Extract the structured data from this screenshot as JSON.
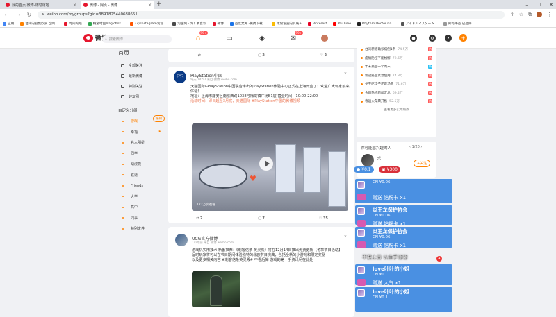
{
  "browser": {
    "tabs": [
      {
        "title": "我的首页 微博-随时随地"
      },
      {
        "title": "微博 - 网页 - 微博"
      }
    ],
    "url": "weibo.com/mygroups?gid=3891825440688651",
    "bookmarks": [
      "应用",
      "台湾的剧集欣赏 全网...",
      "时间的线",
      "畅游时空Magicbox...",
      "(7) Instagram发现...",
      "淘宝网 - 淘！我喜欢",
      "微博",
      "百度文库 -免费下载...",
      "无限设置的扩展+",
      "Pinterest",
      "YouTube",
      "Rhythm Doctor Co...",
      "アイドルマスター S...",
      "所有书签 已选择..."
    ]
  },
  "header": {
    "logo": "微博",
    "search_placeholder": "搜索微博",
    "nav_badge_home": "99+",
    "nav_badge_msg": "99+",
    "compose": "+"
  },
  "leftnav": {
    "title": "首页",
    "main_items": [
      "全部关注",
      "最新微博",
      "特别关注",
      "好友圈"
    ],
    "group_title": "自定义分组",
    "edit_label": "编辑",
    "groups": [
      "游戏",
      "幸福",
      "名人明星",
      "同学",
      "动漫党",
      "铁道",
      "Friends",
      "大学",
      "高中",
      "同事",
      "特别文件"
    ]
  },
  "feedtop": {
    "repost": "",
    "comment": "2",
    "like": "2"
  },
  "post1": {
    "name": "PlayStation中国",
    "meta": "今天 14:57 来自 微博 weibo.com",
    "text1": "天猫国际&PlayStation中国联合推出的PlayStation体验中心正式在上海开业了！欢迎广大玩家前来体验！",
    "text2": "地址：上海市静安区南京西路1038号梅龙镇广场B1层  营业时间：10:00-22:00",
    "text3": "活动时间：即日起至3月底，天猫国际 #PlayStation中国的微博视频",
    "video_label": "172万次观看",
    "actions": {
      "repost": "2",
      "comment": "7",
      "like": "35"
    }
  },
  "post2": {
    "name": "UCG官方微博",
    "meta": "1小时前 来自 微博 weibo.com",
    "text1": "游戏机实用技术 新番推荐：《刺客信条 英灵殿》将在12月14日推出免费更新【冬季节日活动】",
    "text2": "届时玩家将可以在节日期间体验独特的北欧节日庆典，包括全新的小游戏和限定奖励",
    "text3": "以及更多相关内容 #刺客信条英灵殿# 不看后悔 游戏的第一手资讯尽在此处"
  },
  "hotlist": {
    "items": [
      {
        "t": "台湾新增确诊病例1例",
        "v": "74.5万",
        "b": "热"
      },
      {
        "t": "疫情防控不能松懈",
        "v": "72.6万",
        "b": "热"
      },
      {
        "t": "年末最后一个周末",
        "v": "",
        "b": "新"
      },
      {
        "t": "新冠疫苗紧急使用",
        "v": "74.8万",
        "b": "热"
      },
      {
        "t": "冬至吃饺子还是汤圆",
        "v": "71.6万",
        "b": "热"
      },
      {
        "t": "今日热点新闻汇总",
        "v": "69.2万",
        "b": "热"
      },
      {
        "t": "春运火车票开售",
        "v": "52.5万",
        "b": "热"
      }
    ],
    "more": "查看更多实时热点"
  },
  "friend": {
    "title": "你可能感兴趣的人",
    "page": "1/20",
    "name": "乐",
    "follow": "+关注"
  },
  "overlay": {
    "badge_left": "¥0.1",
    "badge_right": "¥300",
    "cards": [
      {
        "name": "",
        "sub": "CN ¥0.06",
        "msg": "赠送 钻粉卡 x1"
      },
      {
        "name": "炎王龙保护协会",
        "sub": "CN ¥0.06",
        "msg": "赠送 钻粉卡 x1"
      },
      {
        "name": "炎王龙保护协会",
        "sub": "CN ¥0.06",
        "msg": "赠送 钻粉卡 x1"
      },
      {
        "name": "love叶叶的小姐",
        "sub": "CN ¥0",
        "msg": "赠送 大气 x1"
      },
      {
        "name": "love叶叶的小姐",
        "sub": "CN ¥0.1",
        "msg": ""
      }
    ],
    "danmu": "不要上首 认住手谢谢",
    "red_count": "4",
    "colors": {
      "card": "#4a90e2",
      "badge_red": "#d9303a",
      "brand": "#ff8200"
    }
  }
}
